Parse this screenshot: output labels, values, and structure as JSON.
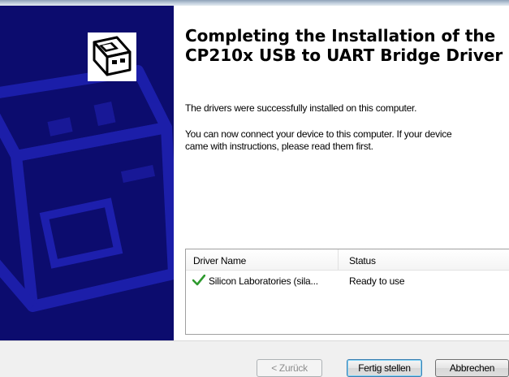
{
  "wizard": {
    "title": "Completing the Installation of the CP210x USB to UART Bridge Driver",
    "message_success": "The drivers were successfully installed on this computer.",
    "message_connect_line1": "You can now connect your device to this computer. If your device",
    "message_connect_line2": "came with instructions, please read them first."
  },
  "driver_table": {
    "columns": [
      "Driver Name",
      "Status"
    ],
    "rows": [
      {
        "name": "Silicon Laboratories (sila...",
        "status": "Ready to use",
        "icon": "check-icon",
        "icon_color": "#2f9a2f"
      }
    ]
  },
  "buttons": {
    "back_label": "< Zurück",
    "finish_label": "Fertig stellen",
    "cancel_label": "Abbrechen"
  },
  "colors": {
    "side_panel": "#0c0c6e",
    "side_panel_art": "#1a1aa8"
  }
}
